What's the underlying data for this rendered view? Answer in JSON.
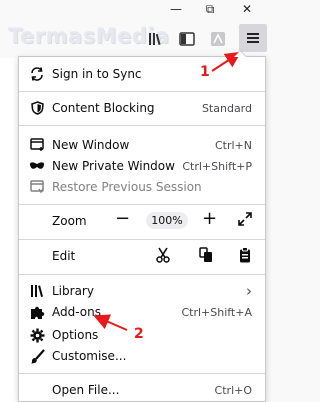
{
  "window_controls": {
    "minimize": "—",
    "maximize": "⧉",
    "close": "✕"
  },
  "watermark": "TermasMedia",
  "toolbar": {
    "library_icon": "library-icon",
    "sidebar_icon": "sidebar-icon",
    "pdf_icon": "pdf-icon",
    "menu_icon": "hamburger-menu-icon"
  },
  "menu": {
    "sign_in": "Sign in to Sync",
    "content_blocking": {
      "label": "Content Blocking",
      "value": "Standard"
    },
    "new_window": {
      "label": "New Window",
      "shortcut": "Ctrl+N"
    },
    "new_private": {
      "label": "New Private Window",
      "shortcut": "Ctrl+Shift+P"
    },
    "restore": "Restore Previous Session",
    "zoom": {
      "label": "Zoom",
      "minus": "−",
      "value": "100%",
      "plus": "+"
    },
    "edit": {
      "label": "Edit"
    },
    "library": {
      "label": "Library",
      "arrow": "›"
    },
    "addons": {
      "label": "Add-ons",
      "shortcut": "Ctrl+Shift+A"
    },
    "options": "Options",
    "customise": "Customise...",
    "open_file": {
      "label": "Open File...",
      "shortcut": "Ctrl+O"
    }
  },
  "annotations": {
    "one": "1",
    "two": "2"
  },
  "colors": {
    "annotation": "#e8191a",
    "menu_button_active": "#d7d7db"
  }
}
